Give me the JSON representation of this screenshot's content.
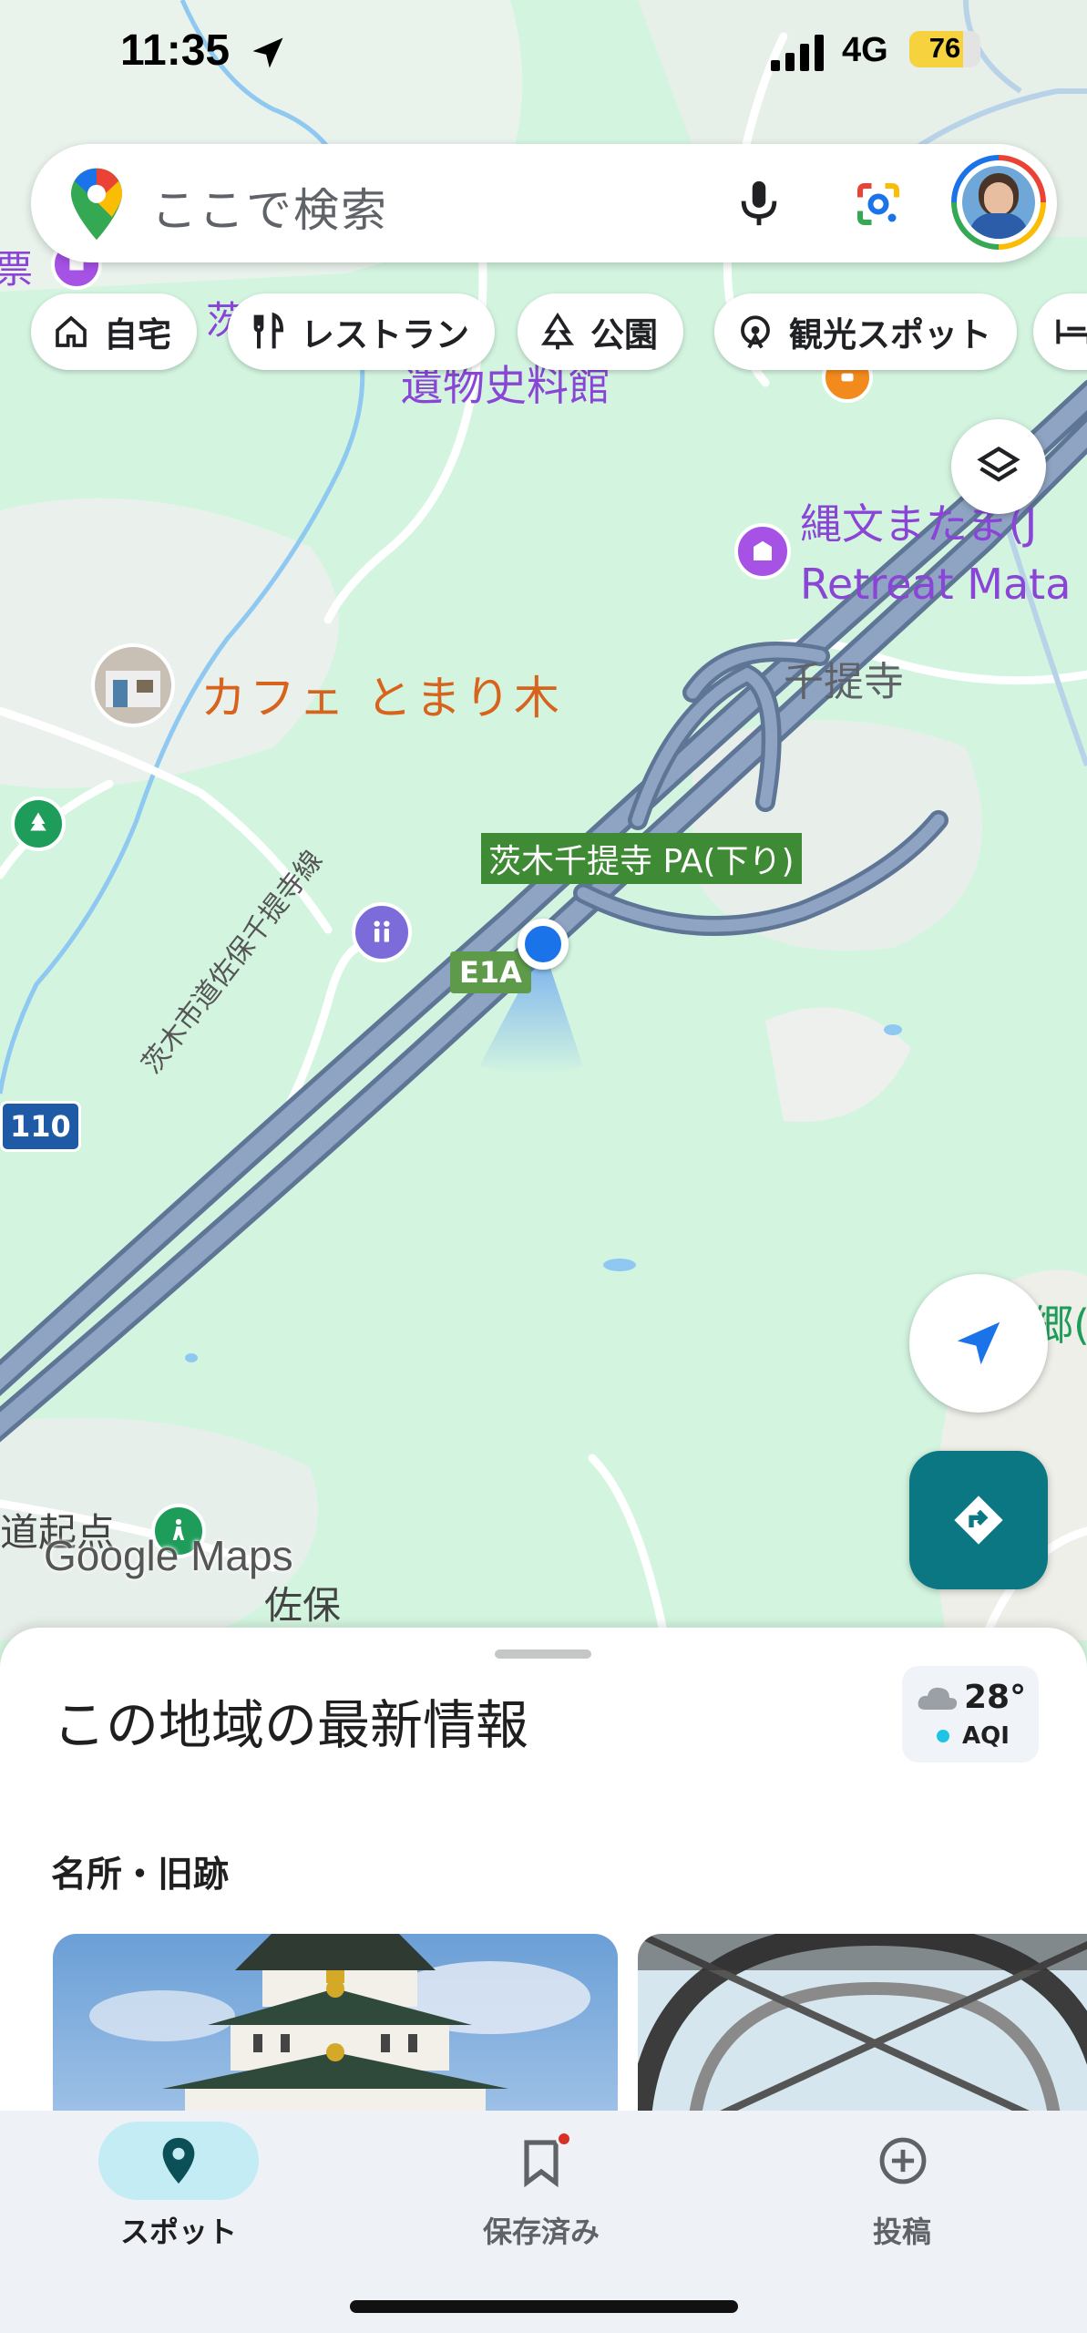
{
  "status_bar": {
    "time": "11:35",
    "network": "4G",
    "battery": "76",
    "battery_level": 0.76
  },
  "search": {
    "placeholder": "ここで検索"
  },
  "chips": [
    {
      "label": "自宅",
      "icon": "home-icon"
    },
    {
      "label": "レストラン",
      "icon": "restaurant-icon"
    },
    {
      "label": "公園",
      "icon": "park-icon"
    },
    {
      "label": "観光スポット",
      "icon": "attraction-icon"
    }
  ],
  "map": {
    "labels": {
      "museum_partial": "遺物史料館",
      "jomon_1": "縄文またま(J",
      "jomon_2": "Retreat Mata",
      "cafe": "カフェ とまり木",
      "senteiji": "千提寺",
      "pa": "茨木千提寺 PA(下り)",
      "route": "E1A",
      "road_number": "110",
      "road_name": "茨木市道佐保千提寺線",
      "left_edge": "道起点",
      "saho": "佐保",
      "top_left": "票",
      "top_chip_edge": "茨",
      "right_edge": "郷(",
      "logo": "Google Maps"
    },
    "colors": {
      "background": "#d3f5e0",
      "highway": "#7d93b3",
      "road": "#ffffff",
      "water": "#8fc8f0"
    }
  },
  "sheet": {
    "title": "この地域の最新情報",
    "weather": {
      "temp": "28°",
      "aqi": "AQI"
    },
    "section_title": "名所・旧跡"
  },
  "nav": {
    "items": [
      {
        "label": "スポット",
        "icon": "location-pin-icon",
        "active": true
      },
      {
        "label": "保存済み",
        "icon": "bookmark-icon",
        "active": false
      },
      {
        "label": "投稿",
        "icon": "add-circle-icon",
        "active": false
      }
    ],
    "accent": "#0b7783"
  }
}
